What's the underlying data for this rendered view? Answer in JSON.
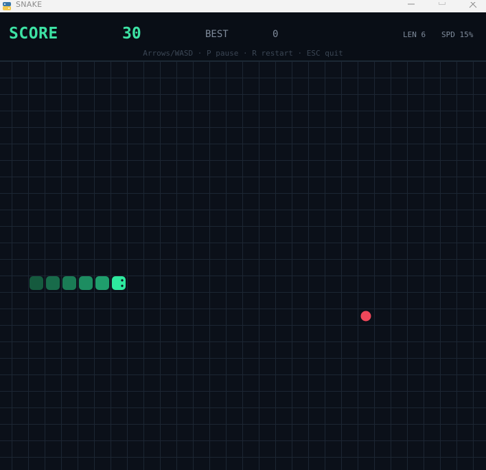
{
  "window": {
    "title": "SNAKE"
  },
  "hud": {
    "score_label": "SCORE",
    "score_value": "30",
    "best_label": "BEST",
    "best_value": "0",
    "length_text": "LEN 6",
    "speed_text": "SPD 15%",
    "controls_hint": "Arrows/WASD · P pause · R restart · ESC quit"
  },
  "colors": {
    "background": "#0b1019",
    "grid_line": "#1c2633",
    "snake_head": "#2ee89e",
    "snake_body": "#1f9e6c",
    "snake_tail": "#155a3e",
    "food": "#f0475a",
    "accent": "#3de2a4"
  },
  "game": {
    "grid_cols": 30,
    "grid_rows": 25,
    "direction": "right",
    "snake": [
      {
        "col": 7,
        "row": 13
      },
      {
        "col": 6,
        "row": 13
      },
      {
        "col": 5,
        "row": 13
      },
      {
        "col": 4,
        "row": 13
      },
      {
        "col": 3,
        "row": 13
      },
      {
        "col": 2,
        "row": 13
      }
    ],
    "food": {
      "col": 22,
      "row": 15
    }
  }
}
